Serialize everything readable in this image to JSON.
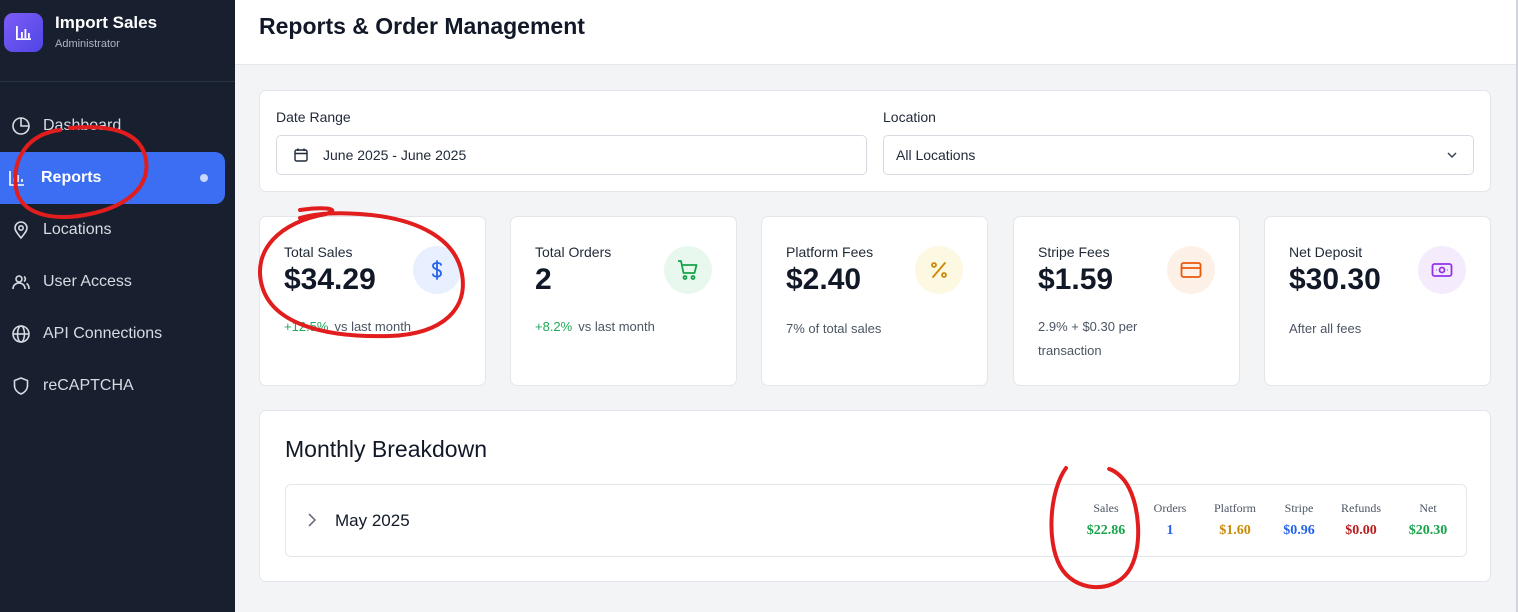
{
  "app": {
    "title": "Import Sales",
    "role": "Administrator"
  },
  "sidebar": {
    "items": [
      {
        "label": "Dashboard",
        "icon": "pie-chart-icon"
      },
      {
        "label": "Reports",
        "icon": "bar-chart-icon",
        "active": true
      },
      {
        "label": "Locations",
        "icon": "map-pin-icon"
      },
      {
        "label": "User Access",
        "icon": "users-icon"
      },
      {
        "label": "API Connections",
        "icon": "globe-icon"
      },
      {
        "label": "reCAPTCHA",
        "icon": "shield-icon"
      }
    ]
  },
  "header": {
    "title": "Reports & Order Management"
  },
  "filters": {
    "date_range": {
      "label": "Date Range",
      "value": "June 2025 - June 2025"
    },
    "location": {
      "label": "Location",
      "value": "All Locations"
    }
  },
  "stats": [
    {
      "label": "Total Sales",
      "value": "$34.29",
      "change": "+12.5%",
      "note": "vs last month",
      "icon": "dollar-icon",
      "icon_color": "#2563eb",
      "icon_bg": "#e8efff"
    },
    {
      "label": "Total Orders",
      "value": "2",
      "change": "+8.2%",
      "note": "vs last month",
      "icon": "cart-icon",
      "icon_color": "#16a34a",
      "icon_bg": "#e9f8ee"
    },
    {
      "label": "Platform Fees",
      "value": "$2.40",
      "note": "7% of total sales",
      "icon": "percent-icon",
      "icon_color": "#ca8a04",
      "icon_bg": "#fdf8e1"
    },
    {
      "label": "Stripe Fees",
      "value": "$1.59",
      "note": "2.9% + $0.30 per transaction",
      "icon": "credit-card-icon",
      "icon_color": "#ea580c",
      "icon_bg": "#fdf1e7"
    },
    {
      "label": "Net Deposit",
      "value": "$30.30",
      "note": "After all fees",
      "icon": "money-icon",
      "icon_color": "#9333ea",
      "icon_bg": "#f4ecfd"
    }
  ],
  "monthly": {
    "title": "Monthly Breakdown",
    "rows": [
      {
        "month": "May 2025",
        "columns": [
          {
            "label": "Sales",
            "value": "$22.86",
            "color": "#16a34a"
          },
          {
            "label": "Orders",
            "value": "1",
            "color": "#2563eb"
          },
          {
            "label": "Platform",
            "value": "$1.60",
            "color": "#ca8a04"
          },
          {
            "label": "Stripe",
            "value": "$0.96",
            "color": "#2563eb"
          },
          {
            "label": "Refunds",
            "value": "$0.00",
            "color": "#b91c1c"
          },
          {
            "label": "Net",
            "value": "$20.30",
            "color": "#16a34a"
          }
        ]
      }
    ]
  },
  "colors": {
    "sidebar_bg": "#18202f",
    "accent": "#3b6ef2",
    "annotation": "#e11d1d"
  }
}
